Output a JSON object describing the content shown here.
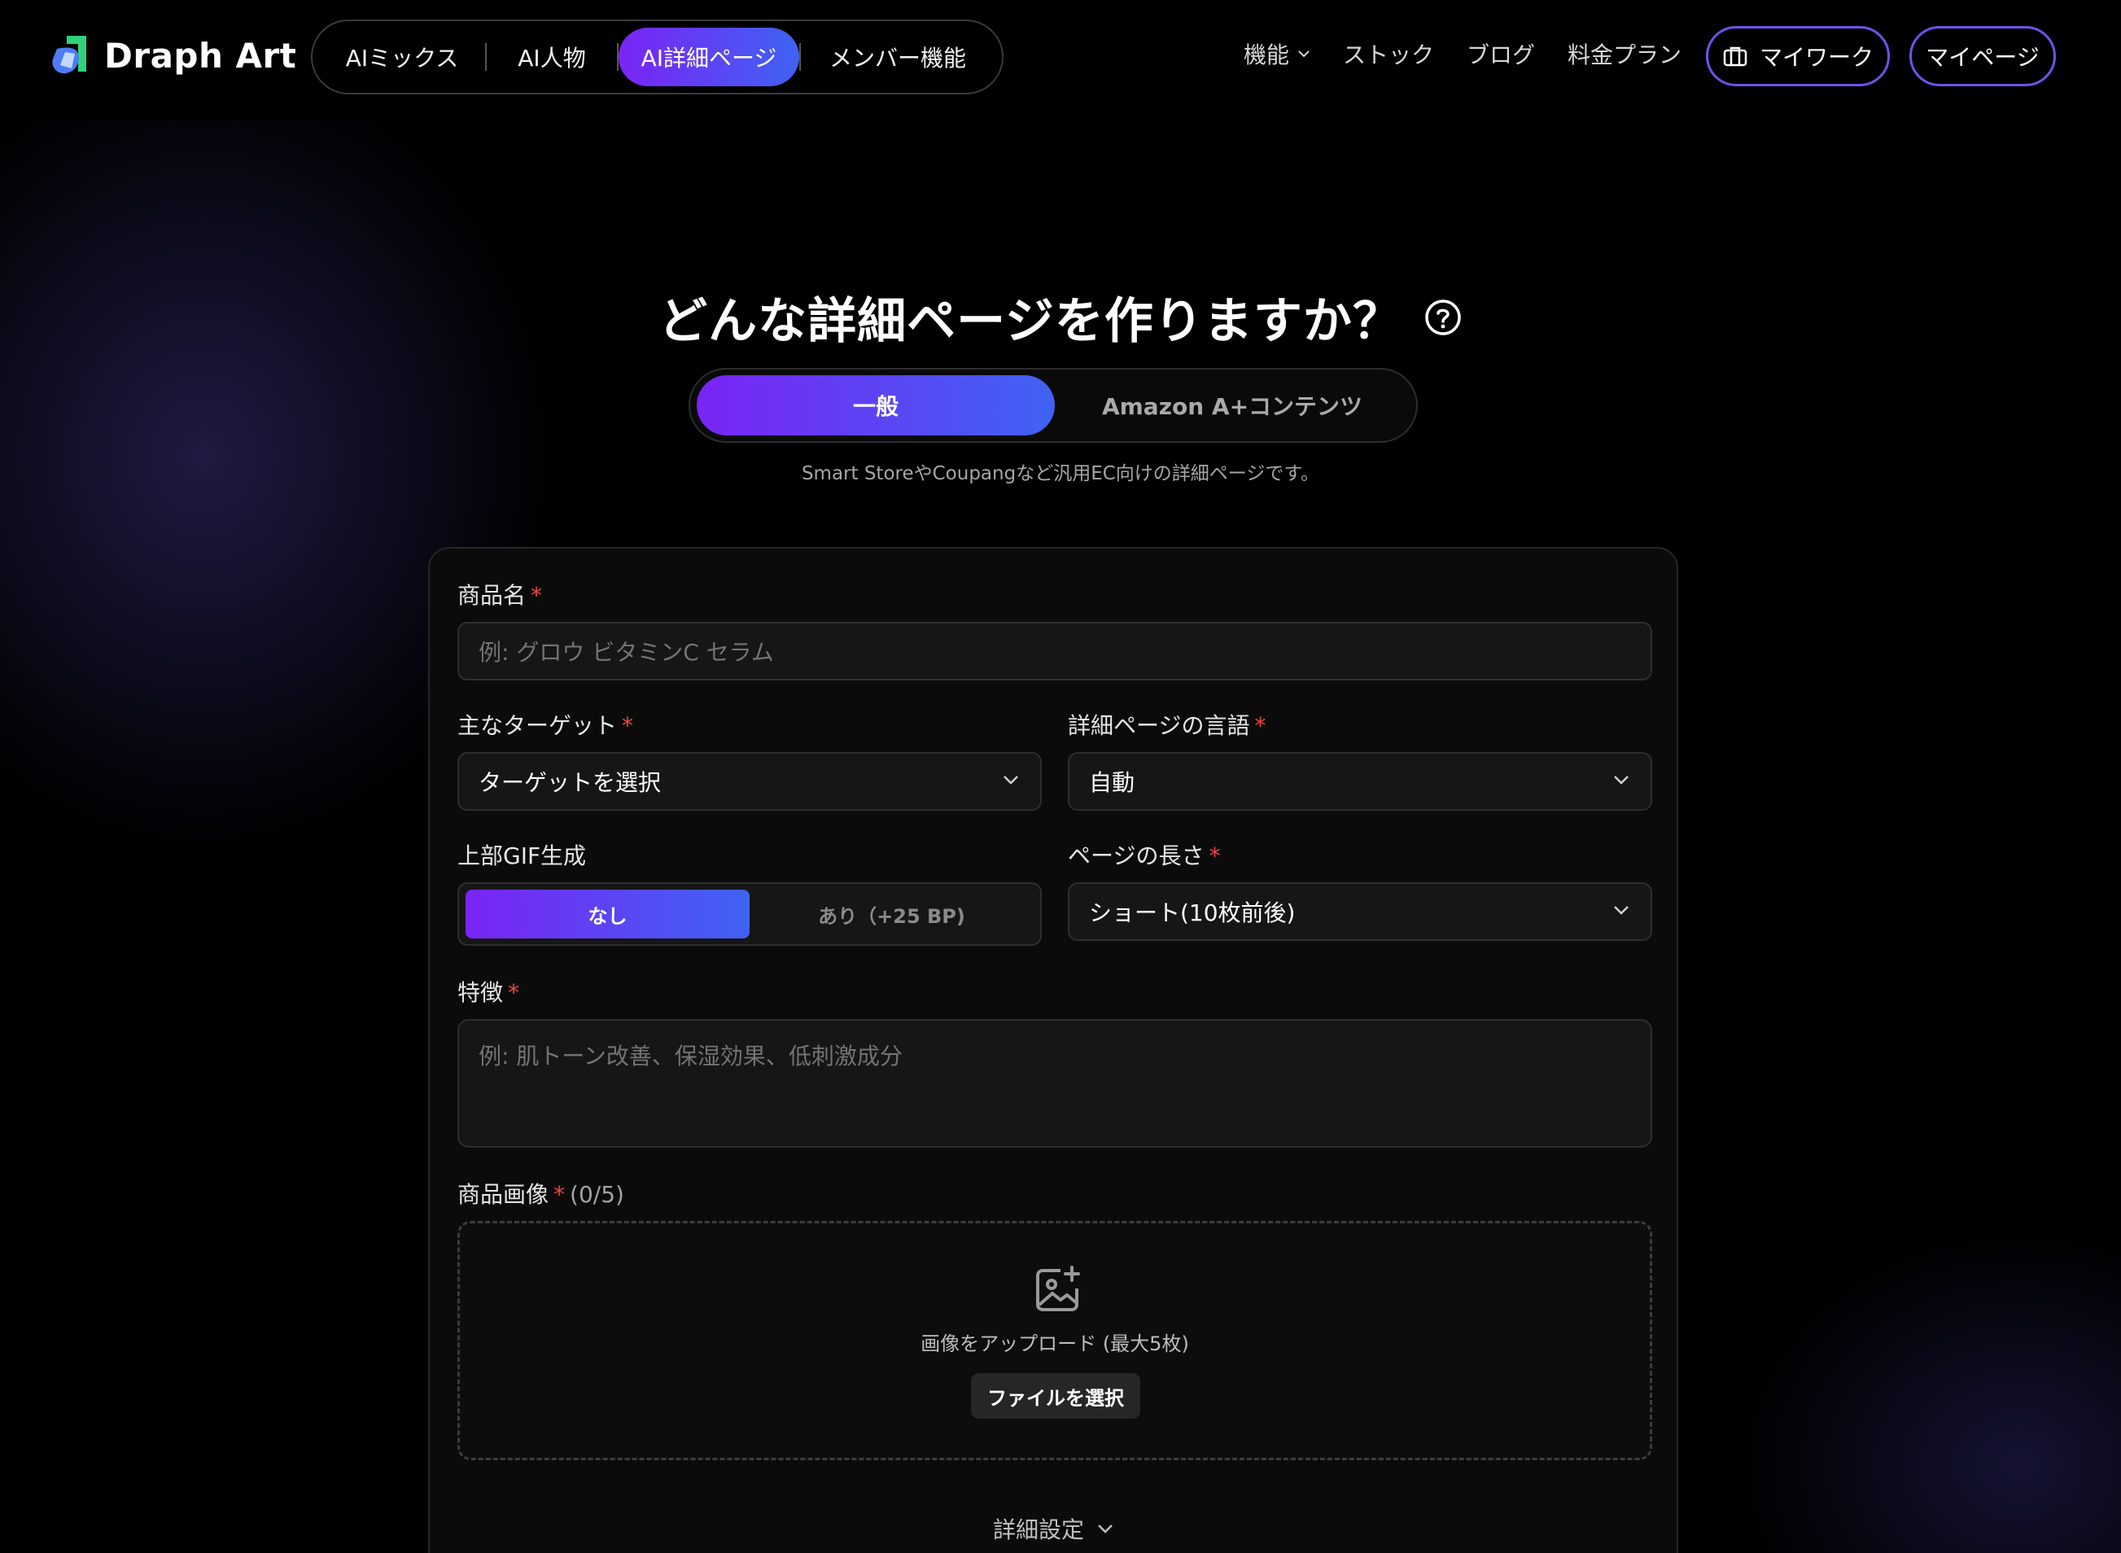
{
  "header": {
    "brand": "Draph Art",
    "tabs": [
      {
        "label": "AIミックス"
      },
      {
        "label": "AI人物"
      },
      {
        "label": "AI詳細ページ",
        "active": true
      },
      {
        "label": "メンバー機能"
      }
    ],
    "links": [
      "機能",
      "ストック",
      "ブログ",
      "料金プラン"
    ],
    "my_work": "マイワーク",
    "my_page": "マイページ"
  },
  "hero": {
    "title": "どんな詳細ページを作りますか？",
    "modes": [
      "一般",
      "Amazon A+コンテンツ"
    ],
    "active_mode": "一般",
    "subtitle": "Smart StoreやCoupangなど汎用EC向けの詳細ページです。"
  },
  "form": {
    "product_name": {
      "label": "商品名",
      "placeholder": "例: グロウ ビタミンC セラム"
    },
    "target": {
      "label": "主なターゲット",
      "value": "ターゲットを選択"
    },
    "language": {
      "label": "詳細ページの言語",
      "value": "自動"
    },
    "gif": {
      "label": "上部GIF生成",
      "options": [
        "なし",
        "あり（+25 BP)"
      ],
      "selected": "なし"
    },
    "length": {
      "label": "ページの長さ",
      "value": "ショート(10枚前後)"
    },
    "features": {
      "label": "特徴",
      "placeholder": "例: 肌トーン改善、保湿効果、低刺激成分"
    },
    "images": {
      "label": "商品画像",
      "count": "(0/5)",
      "upload_text": "画像をアップロード (最大5枚)",
      "button": "ファイルを選択"
    },
    "advanced": "詳細設定",
    "required_mark": "*"
  },
  "colors": {
    "accent_start": "#7a24f5",
    "accent_end": "#3f63f3",
    "required": "#ef4444",
    "background": "#000000"
  }
}
